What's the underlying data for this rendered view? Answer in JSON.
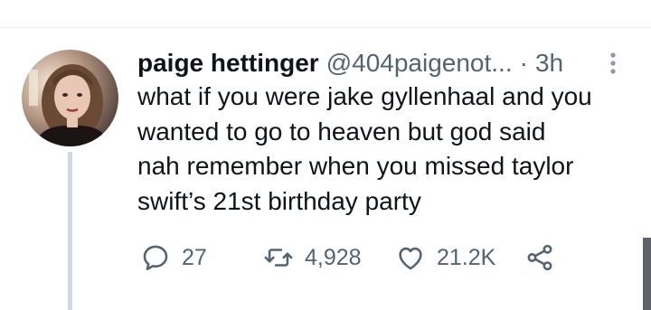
{
  "tweet": {
    "author_name": "paige hettinger",
    "author_handle": "@404paigenot...",
    "separator": "·",
    "timestamp": "3h",
    "text_lines": [
      "what if you were jake gyllenhaal and you",
      "wanted to go to heaven but god said",
      "nah remember when you missed taylor",
      "swift’s 21st birthday party"
    ]
  },
  "actions": {
    "reply_count": "27",
    "retweet_count": "4,928",
    "like_count": "21.2K"
  },
  "icons": {
    "avatar": "avatar-photo",
    "more": "more-vertical-icon",
    "reply": "reply-icon",
    "retweet": "retweet-icon",
    "like": "heart-icon",
    "share": "share-icon"
  },
  "colors": {
    "text": "#0f1419",
    "secondary": "#536471",
    "thread_line": "#cfd9de"
  }
}
